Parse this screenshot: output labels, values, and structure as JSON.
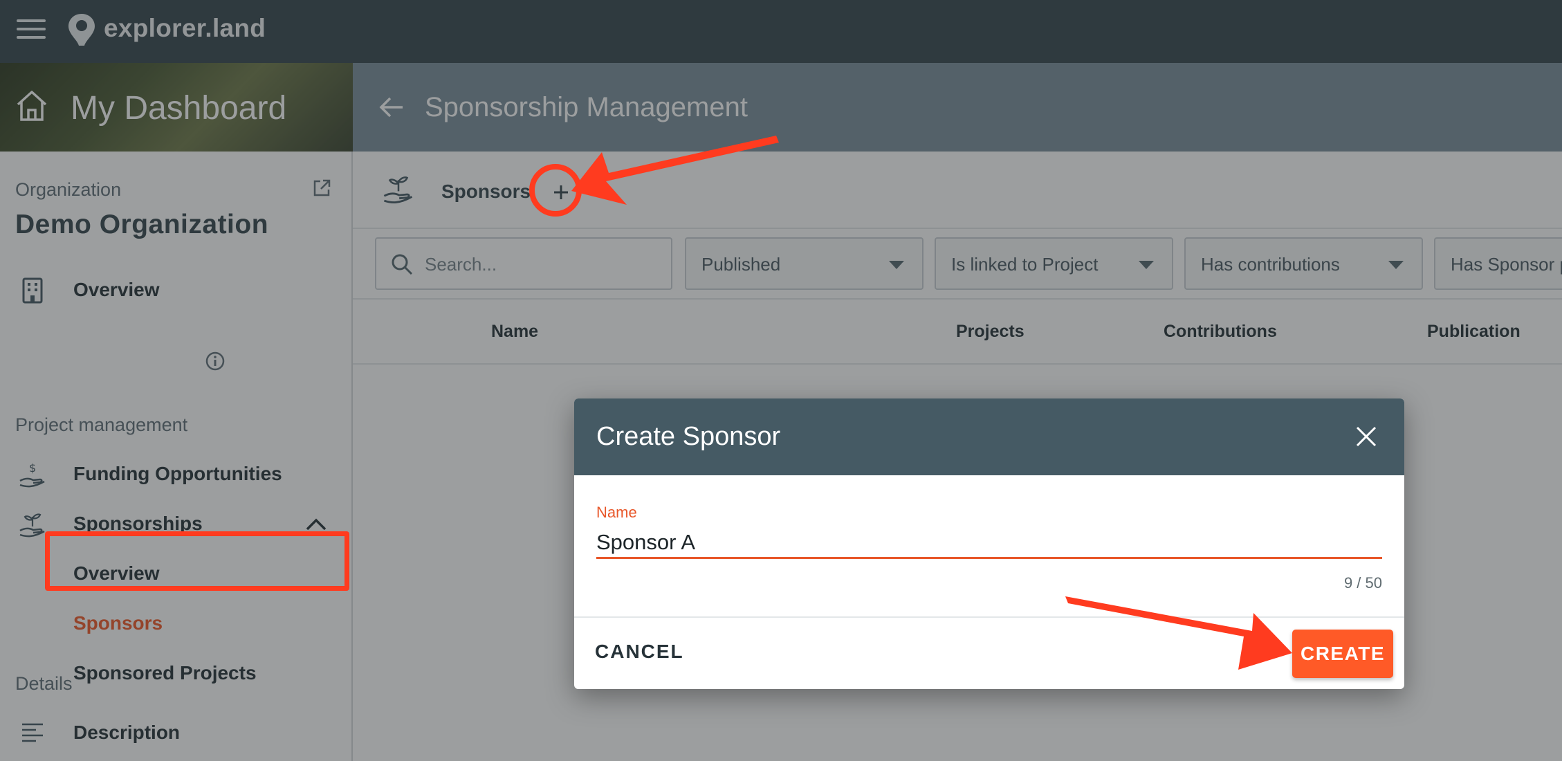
{
  "app": {
    "brand": "explorer.land"
  },
  "sidebar": {
    "header_title": "My Dashboard",
    "org_section_label": "Organization",
    "org_name": "Demo Organization",
    "project_mgmt_label": "Project management",
    "details_label": "Details",
    "items": {
      "overview": "Overview",
      "funding": "Funding Opportunities",
      "sponsorships": "Sponsorships",
      "sub_overview": "Overview",
      "sponsors": "Sponsors",
      "sponsored_projects": "Sponsored Projects",
      "description": "Description"
    }
  },
  "main": {
    "page_title": "Sponsorship Management",
    "toolbar_label": "Sponsors",
    "search_placeholder": "Search...",
    "filters": [
      "Published",
      "Is linked to Project",
      "Has contributions",
      "Has Sponsor p"
    ],
    "columns": {
      "name": "Name",
      "projects": "Projects",
      "contributions": "Contributions",
      "publication": "Publication"
    }
  },
  "dialog": {
    "title": "Create Sponsor",
    "field_label": "Name",
    "field_value": "Sponsor A",
    "counter": "9 / 50",
    "cancel_label": "CANCEL",
    "create_label": "CREATE"
  },
  "colors": {
    "accent": "#f15a29",
    "topbar": "#37474f",
    "dialog_header": "#455a64",
    "annotation": "#ff3b1f"
  }
}
